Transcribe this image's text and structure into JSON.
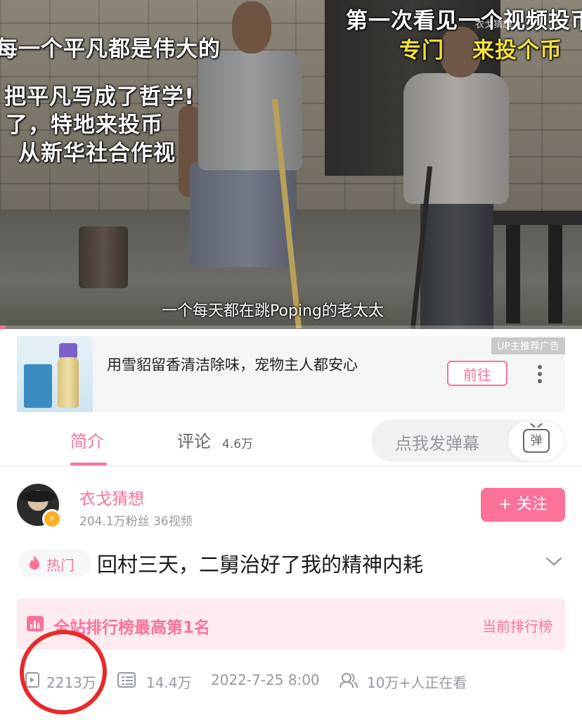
{
  "video": {
    "overlay_lines": [
      "每一个平凡都是伟大的",
      "把平凡写成了哲学!",
      "了，特地来投币",
      "从新华社合作视",
      "第一次看见一个视频投币",
      "专门",
      "来投个币"
    ],
    "watermark": "衣戈猜想",
    "subtitle": "一个每天都在跳Poping的老太太",
    "progress_fraction": 0.01
  },
  "ad": {
    "title": "用雪貂留香清洁除味，宠物主人都安心",
    "tag": "UP主推荐广告",
    "button": "前往",
    "more": "⋮",
    "colors": {
      "accent": "#fb7299"
    }
  },
  "tabs": {
    "intro": "简介",
    "comments": "评论",
    "comments_count": "4.6万",
    "danmaku_placeholder": "点我发弹幕",
    "danmaku_button": "弹"
  },
  "uploader": {
    "name": "衣戈猜想",
    "stats": "204.1万粉丝  36视频",
    "badge": "⚡",
    "follow": "+ 关注"
  },
  "title": {
    "hot_label": "热门",
    "hot_icon": "fire-icon",
    "text": "回村三天，二舅治好了我的精神内耗"
  },
  "rank": {
    "text": "全站排行榜最高第1名",
    "link": "当前排行榜"
  },
  "stats": {
    "plays": "2213万",
    "danmaku": "14.4万",
    "date": "2022-7-25 8:00",
    "watching": "10万+人正在看"
  }
}
